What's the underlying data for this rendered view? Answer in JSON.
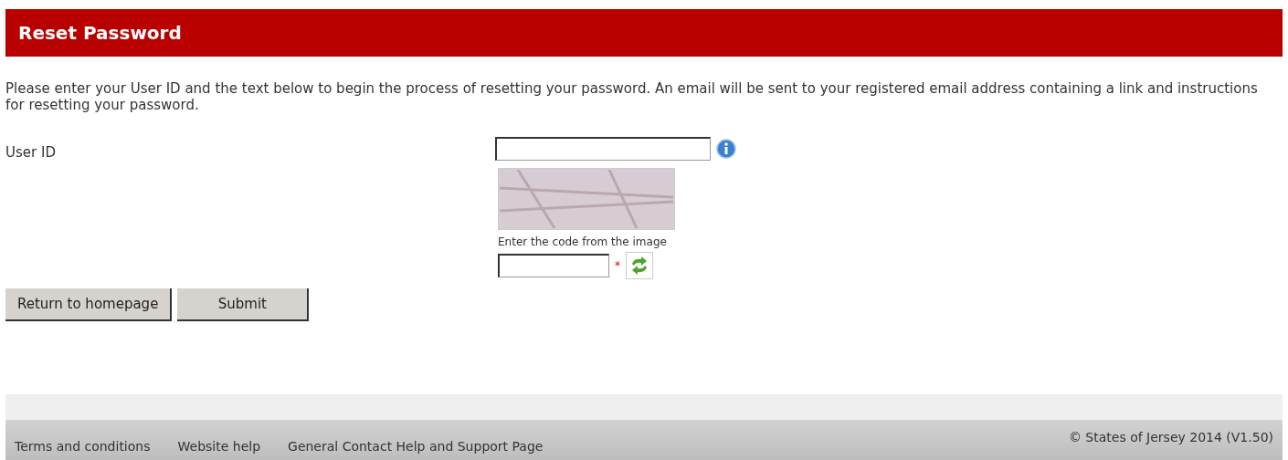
{
  "header": {
    "title": "Reset Password"
  },
  "intro": "Please enter your User ID and the text below to begin the process of resetting your password. An email will be sent to your registered email address containing a link and instructions for resetting your password.",
  "user_id": {
    "label": "User ID"
  },
  "captcha": {
    "hint": "Enter the code from the image",
    "required_mark": "*"
  },
  "buttons": [
    "Return to homepage",
    "Submit"
  ],
  "footer": {
    "links": [
      "Terms and conditions",
      "Website help",
      "General Contact Help and Support Page"
    ],
    "copyright": "© States of Jersey 2014 (V1.50)"
  }
}
